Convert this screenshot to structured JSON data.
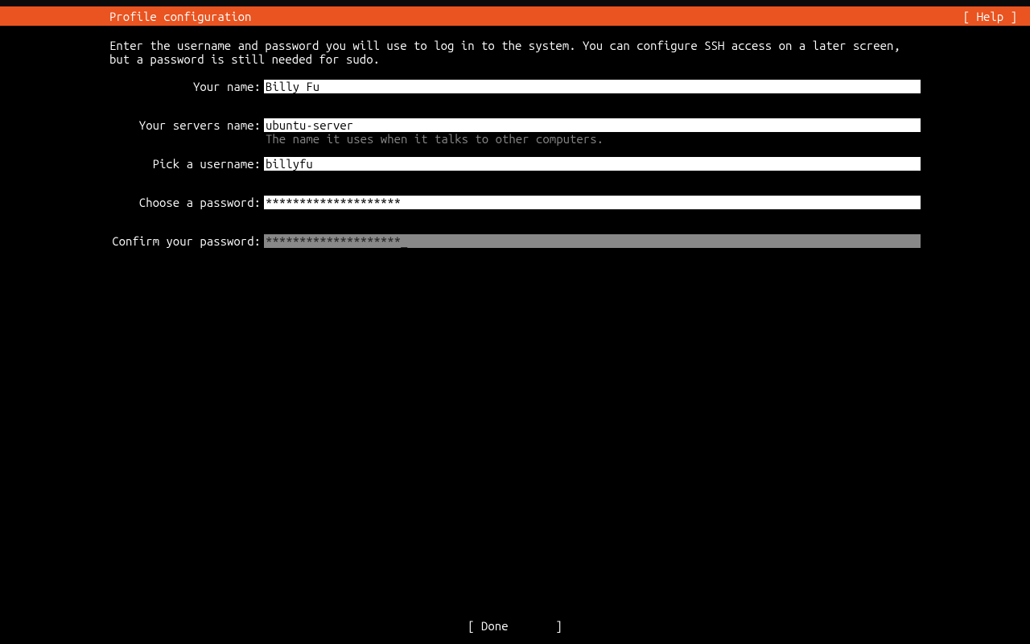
{
  "header": {
    "title": "Profile configuration",
    "help": "[ Help ]"
  },
  "instruction": "Enter the username and password you will use to log in to the system. You can configure SSH access on a later screen, but a password is still needed for sudo.",
  "form": {
    "name": {
      "label": "Your name:",
      "value": "Billy Fu"
    },
    "server_name": {
      "label": "Your servers name:",
      "value": "ubuntu-server",
      "hint": "The name it uses when it talks to other computers."
    },
    "username": {
      "label": "Pick a username:",
      "value": "billyfu"
    },
    "password": {
      "label": "Choose a password:",
      "value": "********************"
    },
    "confirm_password": {
      "label": "Confirm your password:",
      "value": "********************",
      "cursor": "_"
    }
  },
  "footer": {
    "done": "[ Done       ]"
  }
}
